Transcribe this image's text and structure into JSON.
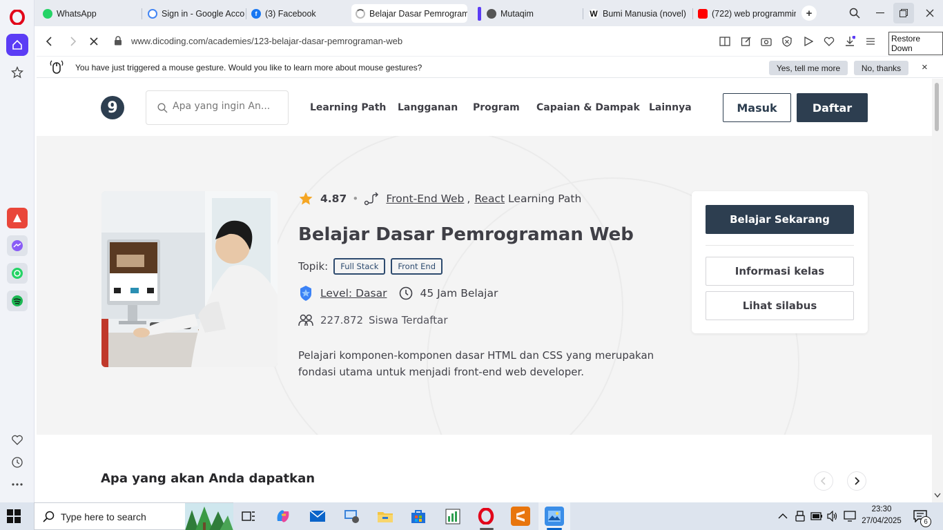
{
  "browser": {
    "tabs": [
      {
        "label": "WhatsApp",
        "active": false
      },
      {
        "label": "Sign in - Google Accou",
        "active": false
      },
      {
        "label": "(3) Facebook",
        "active": false
      },
      {
        "label": "Belajar Dasar Pemrograma",
        "active": true
      },
      {
        "label": "Mutaqim",
        "active": false
      },
      {
        "label": "Bumi Manusia (novel) -",
        "active": false
      },
      {
        "label": "(722) web programmin",
        "active": false
      }
    ],
    "url": "www.dicoding.com/academies/123-belajar-dasar-pemrograman-web",
    "tooltip": "Restore Down"
  },
  "gesture_notice": {
    "text": "You have just triggered a mouse gesture. Would you like to learn more about mouse gestures?",
    "yes_label": "Yes, tell me more",
    "no_label": "No, thanks",
    "close": "×"
  },
  "site": {
    "logo_text": "9",
    "search_placeholder": "Apa yang ingin An...",
    "nav": [
      "Learning Path",
      "Langganan",
      "Program",
      "Capaian & Dampak",
      "Lainnya"
    ],
    "login_label": "Masuk",
    "register_label": "Daftar"
  },
  "course": {
    "rating": "4.87",
    "bullet": "•",
    "path_link_1": "Front-End Web",
    "path_sep": ",",
    "path_link_2": "React",
    "path_suffix": "Learning Path",
    "title": "Belajar Dasar Pemrograman Web",
    "topik_label": "Topik:",
    "tags": [
      "Full Stack",
      "Front End"
    ],
    "level": "Level: Dasar",
    "hours": "45 Jam Belajar",
    "students_count": "227.872",
    "students_label": "Siswa Terdaftar",
    "description": "Pelajari komponen-komponen dasar HTML dan CSS yang merupakan fondasi utama untuk menjadi front-end web developer."
  },
  "cta": {
    "primary": "Belajar Sekarang",
    "info": "Informasi kelas",
    "syllabus": "Lihat silabus"
  },
  "section": {
    "title": "Apa yang akan Anda dapatkan"
  },
  "taskbar": {
    "search_placeholder": "Type here to search",
    "time": "23:30",
    "date": "27/04/2025",
    "notification_count": "6"
  },
  "colors": {
    "primary": "#2d3e50",
    "hero_bg": "#f4f4f4",
    "opera_red": "#e2061a",
    "opera_accent": "#5b3cf5",
    "star": "#f5a623"
  }
}
